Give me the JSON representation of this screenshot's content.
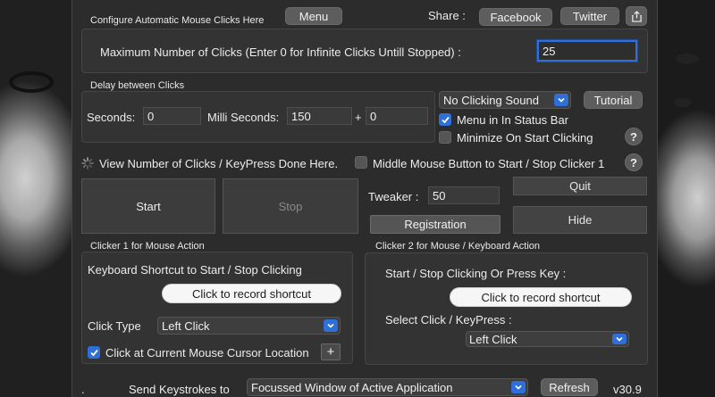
{
  "header": {
    "title": "Configure Automatic Mouse Clicks Here",
    "menu_label": "Menu",
    "share_label": "Share :",
    "facebook_label": "Facebook",
    "twitter_label": "Twitter",
    "share_icon": "share-icon"
  },
  "max_clicks": {
    "label": "Maximum Number of Clicks (Enter 0 for Infinite Clicks Untill Stopped) :",
    "value": "25"
  },
  "delay": {
    "title": "Delay between Clicks",
    "seconds_label": "Seconds:",
    "seconds_value": "0",
    "milli_label": "Milli Seconds:",
    "milli_value": "150",
    "plus": "+",
    "random_value": "0"
  },
  "options": {
    "sound_selected": "No Clicking Sound",
    "tutorial_label": "Tutorial",
    "menu_status_bar_label": "Menu in In Status Bar",
    "menu_status_bar_checked": true,
    "minimize_label": "Minimize On Start Clicking",
    "minimize_checked": false,
    "help_label": "?"
  },
  "status": {
    "view_label": "View Number of Clicks / KeyPress Done Here.",
    "middle_mouse_label": "Middle Mouse Button to Start / Stop Clicker 1",
    "middle_mouse_checked": false
  },
  "controls": {
    "start_label": "Start",
    "stop_label": "Stop",
    "tweaker_label": "Tweaker :",
    "tweaker_value": "50",
    "registration_label": "Registration",
    "quit_label": "Quit",
    "hide_label": "Hide"
  },
  "clicker1": {
    "title": "Clicker 1 for Mouse Action",
    "shortcut_label": "Keyboard Shortcut to Start / Stop Clicking",
    "record_label": "Click to record shortcut",
    "click_type_label": "Click Type",
    "click_type_value": "Left Click",
    "cursor_location_label": "Click at Current Mouse Cursor Location",
    "cursor_location_checked": true,
    "add_label": "+"
  },
  "clicker2": {
    "title": "Clicker 2 for Mouse / Keyboard Action",
    "press_key_label": "Start / Stop Clicking Or Press Key :",
    "record_label": "Click to record shortcut",
    "select_label": "Select Click / KeyPress :",
    "select_value": "Left Click"
  },
  "footer": {
    "dot": ".",
    "send_label": "Send Keystrokes to",
    "target_value": "Focussed Window of Active Application",
    "refresh_label": "Refresh",
    "version": "v30.9"
  }
}
